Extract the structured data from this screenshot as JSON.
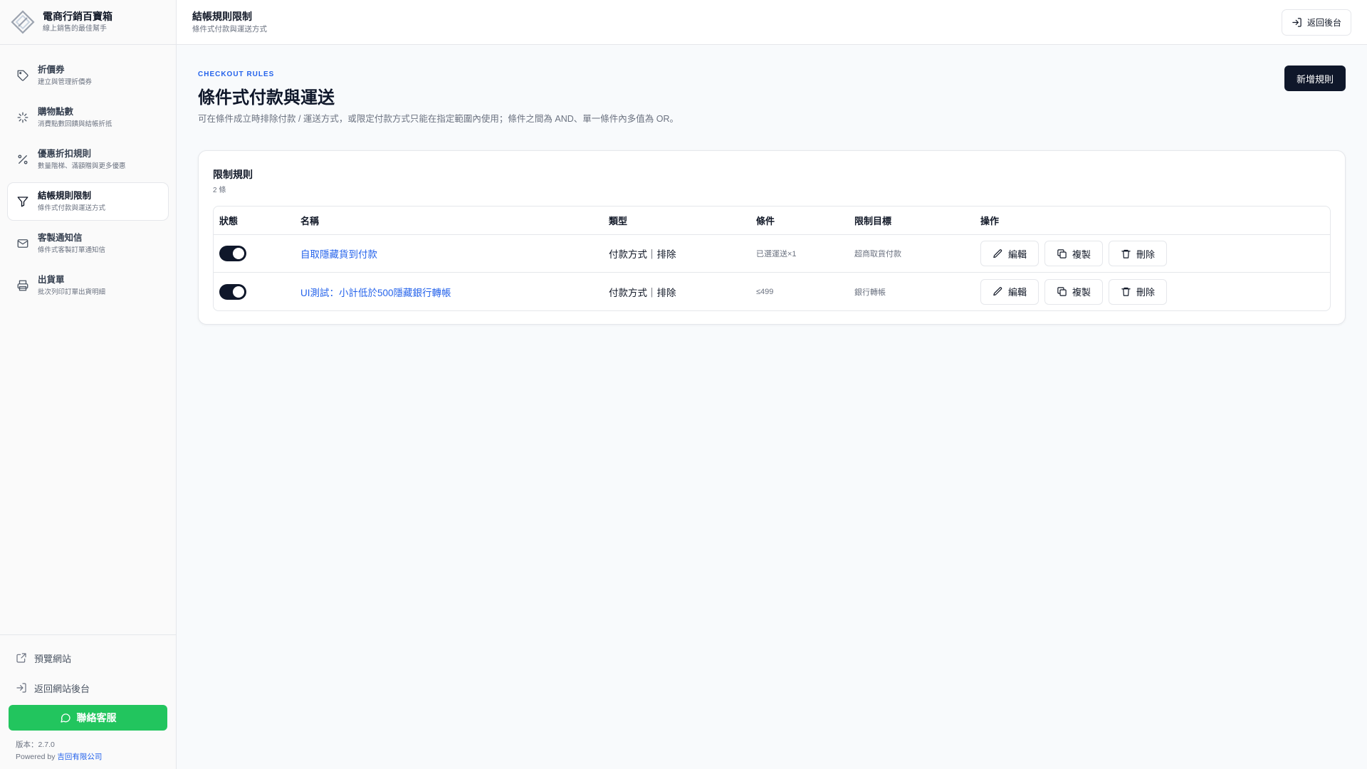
{
  "brand": {
    "title": "電商行銷百寶箱",
    "subtitle": "線上銷售的最佳幫手"
  },
  "topbar": {
    "title": "結帳規則限制",
    "subtitle": "條件式付款與運送方式",
    "back_label": "返回後台"
  },
  "sidebar": {
    "items": [
      {
        "label": "折價券",
        "sub": "建立與管理折價券",
        "icon": "tag-icon"
      },
      {
        "label": "購物點數",
        "sub": "消費點數回饋與結帳折抵",
        "icon": "sparkle-icon"
      },
      {
        "label": "優惠折扣規則",
        "sub": "數量階梯、滿額贈與更多優惠",
        "icon": "percent-icon"
      },
      {
        "label": "結帳規則限制",
        "sub": "條件式付款與運送方式",
        "icon": "filter-icon"
      },
      {
        "label": "客製通知信",
        "sub": "條件式客製訂單通知信",
        "icon": "mail-icon"
      },
      {
        "label": "出貨單",
        "sub": "批次列印訂單出貨明細",
        "icon": "printer-icon"
      }
    ],
    "preview_label": "預覽網站",
    "back_label": "返回網站後台",
    "contact_label": "聯絡客服",
    "version_label": "版本：2.7.0",
    "powered_label": "Powered by",
    "powered_company": "吉回有限公司"
  },
  "page": {
    "eyebrow": "CHECKOUT RULES",
    "title": "條件式付款與運送",
    "description": "可在條件成立時排除付款 / 運送方式，或限定付款方式只能在指定範圍內使用；條件之間為 AND、單一條件內多值為 OR。",
    "add_label": "新增規則"
  },
  "card": {
    "title": "限制規則",
    "count": "2 條",
    "columns": [
      "狀態",
      "名稱",
      "類型",
      "條件",
      "限制目標",
      "操作"
    ],
    "rows": [
      {
        "enabled": true,
        "name": "自取隱藏貨到付款",
        "type": "付款方式｜排除",
        "condition": "已選運送×1",
        "target": "超商取貨付款"
      },
      {
        "enabled": true,
        "name": "UI測試：小計低於500隱藏銀行轉帳",
        "type": "付款方式｜排除",
        "condition": "≤499",
        "target": "銀行轉帳"
      }
    ],
    "actions": {
      "edit": "編輯",
      "copy": "複製",
      "delete": "刪除"
    }
  },
  "colors": {
    "accent": "#2563eb",
    "primary": "#0f172a",
    "contact": "#22c55e"
  }
}
